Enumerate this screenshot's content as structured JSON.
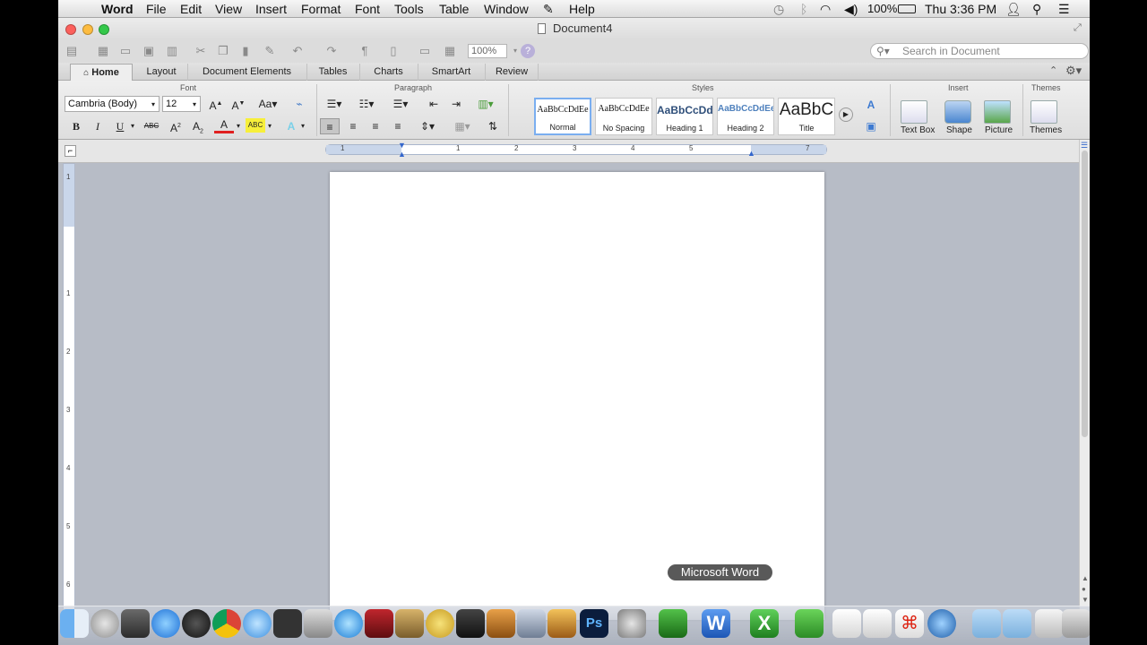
{
  "menubar": {
    "app_name": "Word",
    "items": [
      "File",
      "Edit",
      "View",
      "Insert",
      "Format",
      "Font",
      "Tools",
      "Table",
      "Window",
      "Help"
    ],
    "battery": "100%",
    "clock": "Thu 3:36 PM"
  },
  "window": {
    "title": "Document4"
  },
  "toolbar": {
    "zoom": "100%",
    "search_placeholder": "Search in Document"
  },
  "tabs": [
    "Home",
    "Layout",
    "Document Elements",
    "Tables",
    "Charts",
    "SmartArt",
    "Review"
  ],
  "active_tab": "Home",
  "ribbon": {
    "groups": {
      "font": "Font",
      "paragraph": "Paragraph",
      "styles": "Styles",
      "insert": "Insert",
      "themes": "Themes"
    },
    "font_name": "Cambria (Body)",
    "font_size": "12",
    "styles": [
      {
        "preview": "AaBbCcDdEe",
        "name": "Normal"
      },
      {
        "preview": "AaBbCcDdEe",
        "name": "No Spacing"
      },
      {
        "preview": "AaBbCcDd",
        "name": "Heading 1"
      },
      {
        "preview": "AaBbCcDdEe",
        "name": "Heading 2"
      },
      {
        "preview": "AaBbC",
        "name": "Title"
      }
    ],
    "insert_items": [
      "Text Box",
      "Shape",
      "Picture"
    ],
    "themes_label": "Themes"
  },
  "ruler": {
    "numbers": [
      "1",
      "1",
      "2",
      "3",
      "4",
      "5",
      "7"
    ]
  },
  "vruler": {
    "numbers": [
      "1",
      "1",
      "2",
      "3",
      "4",
      "5",
      "6"
    ]
  },
  "dock": {
    "tooltip": "Microsoft Word"
  },
  "colors": {
    "word_blue": "#2b6fd6",
    "excel_green": "#34a63b",
    "accent_blue": "#4a90d9"
  }
}
